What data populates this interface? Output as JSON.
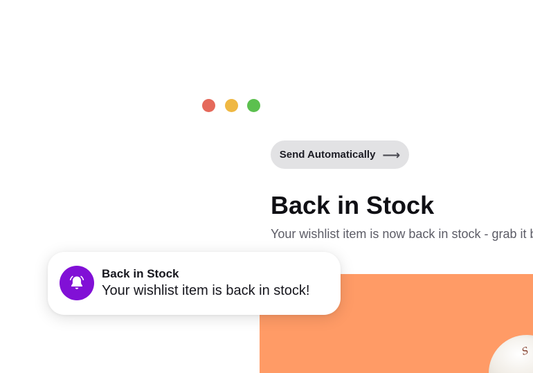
{
  "window": {
    "controls": [
      "close",
      "minimize",
      "maximize"
    ],
    "control_colors": {
      "close": "#e5695b",
      "minimize": "#efb843",
      "maximize": "#5cc04f"
    }
  },
  "action": {
    "label": "Send Automatically",
    "icon": "arrow-right-icon",
    "arrow_glyph": "⟶"
  },
  "message": {
    "title": "Back in Stock",
    "subtitle": "Your wishlist item is now back in stock - grab it before it's gone"
  },
  "hero": {
    "background_color": "#ff9b66",
    "image": "product-image"
  },
  "notification": {
    "icon": "bell-icon",
    "icon_color": "#8110d6",
    "title": "Back in Stock",
    "body": "Your wishlist item is back in stock!"
  }
}
